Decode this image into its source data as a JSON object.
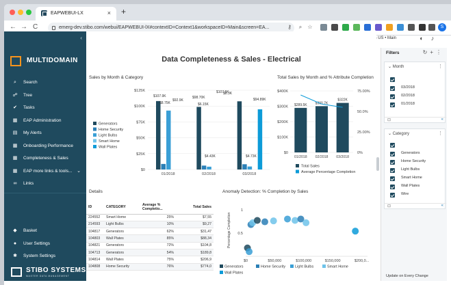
{
  "browser": {
    "tab_title": "EAPWEBUI-LX",
    "url": "emerg-dev.stibo.com/webui/EAPWEBUI-lX#contextID=Context1&workspaceID=Main&screen=EA...",
    "avatar_letter": "S",
    "new_tab": "+",
    "close_tab": "×",
    "nav_icons": {
      "back": "←",
      "forward": "→",
      "reload": "C"
    }
  },
  "app": {
    "user_info": "stiboew • English US • Main",
    "collapse_symbol": "‹",
    "brand_name": "MULTIDOMAIN"
  },
  "sidebar": {
    "items": [
      {
        "icon": "⌕",
        "icon_name": "search-icon",
        "label": "Search"
      },
      {
        "icon": "☍",
        "icon_name": "tree-icon",
        "label": "Tree"
      },
      {
        "icon": "✔",
        "icon_name": "tasks-icon",
        "label": "Tasks"
      },
      {
        "icon": "▦",
        "icon_name": "eap-admin-icon",
        "label": "EAP Administration"
      },
      {
        "icon": "▤",
        "icon_name": "alerts-icon",
        "label": "My Alerts"
      },
      {
        "icon": "▦",
        "icon_name": "dashboard-icon",
        "label": "Onboarding Performance"
      },
      {
        "icon": "▦",
        "icon_name": "dashboard-icon",
        "label": "Completeness & Sales"
      },
      {
        "icon": "▦",
        "icon_name": "links-icon",
        "label": "EAP more links & tools...",
        "chevron": "⌄"
      },
      {
        "icon": "∞",
        "icon_name": "link-icon",
        "label": "Links"
      }
    ],
    "bottom_items": [
      {
        "icon": "◆",
        "icon_name": "basket-icon",
        "label": "Basket"
      },
      {
        "icon": "●",
        "icon_name": "user-icon",
        "label": "User Settings"
      },
      {
        "icon": "✱",
        "icon_name": "gear-icon",
        "label": "System Settings"
      }
    ],
    "footer_brand": "STIBO SYSTEMS",
    "footer_tagline": "MASTER DATA MANAGEMENT"
  },
  "page": {
    "title": "Data Completeness & Sales - Electrical"
  },
  "sales_chart": {
    "title": "Sales by Month & Category",
    "y_ticks": [
      "$125K",
      "$100K",
      "$75K",
      "$50K",
      "$25K",
      "$0"
    ],
    "legend": [
      "Generators",
      "Home Security",
      "Light Bulbs",
      "Smart Home",
      "Wall Plates"
    ],
    "data_labels": [
      "$107.9K",
      "$8.75K",
      "$92.9K",
      "$98.70K",
      "$6.15K",
      "$107.5K",
      "$8.3K",
      "$94.89K",
      "$4.43K",
      "$4.73K"
    ]
  },
  "total_chart": {
    "title": "Total Sales by Month and % Attribute Completion",
    "y_left": [
      "$400K",
      "$300K",
      "$200K",
      "$100K",
      "$0"
    ],
    "y_right": [
      "75.00%",
      "50.0%",
      "25.00%",
      "0%"
    ],
    "data_labels": [
      "$289.5K",
      "$300.7K",
      "$322K"
    ],
    "legend": [
      "Total Sales",
      "Average Percentage Completion"
    ]
  },
  "details": {
    "title": "Details",
    "columns": [
      "ID",
      "CATEGORY",
      "Average % Completio...",
      "Total Sales"
    ],
    "rows": [
      [
        "224552",
        "Smart Home",
        "25%",
        "$7,55"
      ],
      [
        "214593",
        "Light Bulbs",
        "10%",
        "$9,27"
      ],
      [
        "104817",
        "Generators",
        "62%",
        "$31,47"
      ],
      [
        "104803",
        "Wall Plates",
        "85%",
        "$88,34"
      ],
      [
        "104821",
        "Generators",
        "72%",
        "$104,8"
      ],
      [
        "104713",
        "Generators",
        "54%",
        "$189,8"
      ],
      [
        "104814",
        "Wall Plates",
        "75%",
        "$206,9"
      ],
      [
        "104808",
        "Home Security",
        "76%",
        "$774,0"
      ]
    ]
  },
  "anomaly_chart": {
    "title": "Anomaly Detection: % Completion by Sales",
    "y_label": "Percentage Completion",
    "y_ticks": [
      "1",
      "0.5"
    ],
    "x_ticks": [
      "$0",
      "$50,000",
      "$100,000",
      "$150,000",
      "$200,0..."
    ],
    "legend": [
      "Generators",
      "Home Security",
      "Light Bulbs",
      "Smart Home",
      "Wall Plates"
    ]
  },
  "filters": {
    "title": "Filters",
    "month": {
      "label": "Month",
      "options": [
        "03/2018",
        "02/2018",
        "01/2018"
      ]
    },
    "category": {
      "label": "Category",
      "options": [
        "Generators",
        "Home Security",
        "Light Bulbs",
        "Smart Home",
        "Wall Plates",
        "Wire"
      ]
    },
    "update_text": "Update on Every Change"
  },
  "colors": {
    "sidebar_bg": "#1f4a5e",
    "brand_accent": "#f7941d",
    "gen": "#1f4a5e",
    "homesec": "#2b7fb6",
    "bulbs": "#3a9fd6",
    "smart": "#6ec3ea",
    "wall": "#0d9bd8"
  },
  "chart_data": [
    {
      "type": "bar",
      "title": "Sales by Month & Category",
      "categories": [
        "01/2018",
        "02/2018",
        "03/2018"
      ],
      "ylim": [
        0,
        125000
      ],
      "series": [
        {
          "name": "Generators",
          "values": [
            107900,
            98700,
            107500
          ]
        },
        {
          "name": "Home Security",
          "values": [
            8750,
            6150,
            8300
          ]
        },
        {
          "name": "Light Bulbs",
          "values": [
            92900,
            4430,
            4730
          ]
        },
        {
          "name": "Smart Home",
          "values": [
            0,
            0,
            0
          ]
        },
        {
          "name": "Wall Plates",
          "values": [
            0,
            0,
            94890
          ]
        }
      ]
    },
    {
      "type": "bar",
      "title": "Total Sales by Month and % Attribute Completion",
      "categories": [
        "01/2018",
        "02/2018",
        "03/2018"
      ],
      "ylim": [
        0,
        400000
      ],
      "series": [
        {
          "name": "Total Sales",
          "values": [
            289500,
            300700,
            322000
          ]
        },
        {
          "name": "Average Percentage Completion",
          "values": [
            70,
            59,
            55
          ]
        }
      ]
    },
    {
      "type": "scatter",
      "title": "Anomaly Detection: % Completion by Sales",
      "ylabel": "Percentage Completion",
      "xlim": [
        0,
        210000
      ],
      "ylim": [
        0,
        1.1
      ],
      "points": [
        {
          "x": 3000,
          "y": 0.18,
          "cat": "Generators"
        },
        {
          "x": 6000,
          "y": 0.1,
          "cat": "Light Bulbs"
        },
        {
          "x": 9000,
          "y": 0.68,
          "cat": "Home Security"
        },
        {
          "x": 12000,
          "y": 0.72,
          "cat": "Smart Home"
        },
        {
          "x": 20000,
          "y": 0.77,
          "cat": "Generators"
        },
        {
          "x": 33000,
          "y": 0.74,
          "cat": "Home Security"
        },
        {
          "x": 48000,
          "y": 0.76,
          "cat": "Smart Home"
        },
        {
          "x": 72000,
          "y": 0.8,
          "cat": "Light Bulbs"
        },
        {
          "x": 85000,
          "y": 0.77,
          "cat": "Smart Home"
        },
        {
          "x": 95000,
          "y": 0.8,
          "cat": "Home Security"
        },
        {
          "x": 104000,
          "y": 0.72,
          "cat": "Smart Home"
        },
        {
          "x": 189000,
          "y": 0.54,
          "cat": "Wall Plates"
        }
      ]
    }
  ]
}
